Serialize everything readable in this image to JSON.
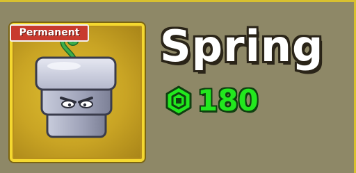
{
  "item": {
    "badge": "Permanent",
    "name": "Spring",
    "price": "180",
    "currency_icon": "robux-icon",
    "fruit_icon": "spring-fruit-icon"
  },
  "colors": {
    "background": "#8e8867",
    "card_fill": "#c9a424",
    "card_border": "#f4d830",
    "badge_red": "#c83a2e",
    "price_green": "#22e81e",
    "name_white": "#ffffff"
  }
}
